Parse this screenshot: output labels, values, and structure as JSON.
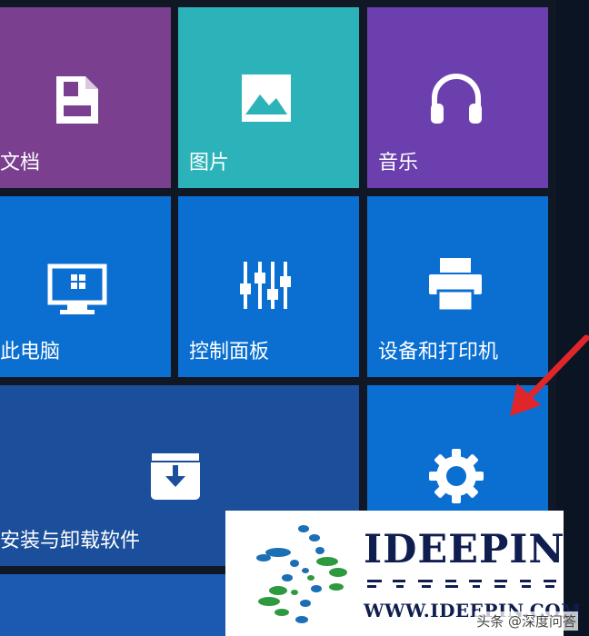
{
  "tiles": [
    {
      "id": "docs",
      "label": "文档",
      "icon": "document-icon"
    },
    {
      "id": "pictures",
      "label": "图片",
      "icon": "picture-icon"
    },
    {
      "id": "music",
      "label": "音乐",
      "icon": "headphones-icon"
    },
    {
      "id": "this_pc",
      "label": "此电脑",
      "icon": "computer-icon"
    },
    {
      "id": "control_panel",
      "label": "控制面板",
      "icon": "sliders-icon"
    },
    {
      "id": "devices_printers",
      "label": "设备和打印机",
      "icon": "printer-icon"
    },
    {
      "id": "uninstall",
      "label": "安装与卸载软件",
      "icon": "install-box-icon"
    },
    {
      "id": "settings",
      "label": "",
      "icon": "gear-icon"
    }
  ],
  "watermark": {
    "brand": "IDEEPIN",
    "url": "WWW.IDEEPIN.COM"
  },
  "source_tag": "头条 @深度问答",
  "colors": {
    "purple_tile": "#7b3f8f",
    "teal_tile": "#2bb3b9",
    "violet_tile": "#6b3fad",
    "blue_tile": "#0a6fd0",
    "dark_blue_tile": "#1c4f9b",
    "arrow": "#e0262b"
  }
}
